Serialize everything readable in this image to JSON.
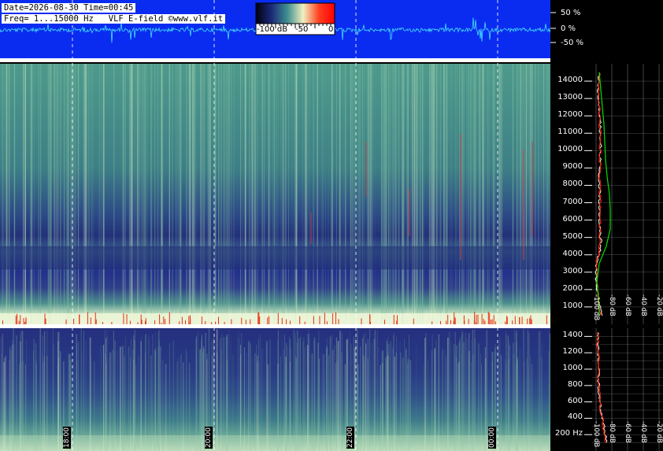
{
  "header": {
    "line1": "Date=2026-08-30 Time=00:45",
    "line2": "Freq= 1...15000 Hz   VLF E-field ©www.vlf.it"
  },
  "colorbar": {
    "labels": [
      "-100 dB",
      "-50",
      "0"
    ],
    "colors": [
      "#000010",
      "#1b2a78",
      "#3f8f8f",
      "#f0f0c0",
      "#ff4020",
      "#ff0000"
    ]
  },
  "waveform_axis": {
    "labels": [
      "50 %",
      "0 %",
      "-50 %"
    ]
  },
  "colors": {
    "waveform_bg": "#0a2cf0",
    "waveform_line": "#45e0ff",
    "spectrum_white": "#ffffff",
    "spectrum_red": "#ff2000",
    "spectrum_green": "#00e000"
  },
  "chart_data": [
    {
      "type": "line",
      "title": "",
      "panel": "waveform",
      "ylabels": [
        "50 %",
        "0 %",
        "-50 %"
      ],
      "ylim": [
        -75,
        75
      ]
    },
    {
      "type": "heatmap",
      "panel": "spectrogram-full",
      "yunit": "Hz",
      "ylim": [
        0,
        15000
      ],
      "yticks": [
        1000,
        2000,
        3000,
        4000,
        5000,
        6000,
        7000,
        8000,
        9000,
        10000,
        11000,
        12000,
        13000,
        14000
      ],
      "ytick_labels": [
        "1000",
        "2000",
        "3000",
        "4000",
        "5000",
        "6000",
        "7000",
        "8000",
        "9000",
        "10000",
        "11000",
        "12000",
        "13000",
        "14000"
      ],
      "colorscale_db": [
        -100,
        0
      ]
    },
    {
      "type": "heatmap",
      "panel": "spectrogram-low",
      "yunit": "Hz",
      "ylim": [
        0,
        1500
      ],
      "yticks": [
        200,
        400,
        600,
        800,
        1000,
        1200,
        1400
      ],
      "ytick_labels": [
        "200 Hz",
        "400",
        "600",
        "800",
        "1000",
        "1200",
        "1400"
      ],
      "xtick_labels": [
        "18:00",
        "20:00",
        "22:00",
        "00:00"
      ],
      "colorscale_db": [
        -100,
        0
      ]
    },
    {
      "type": "line",
      "panel": "spectrum-profile-full",
      "xticks_db": [
        -100,
        -80,
        -60,
        -40,
        -20
      ],
      "xtick_labels": [
        "-100 dB",
        "-80 dB",
        "-60 dB",
        "-40 dB",
        "-20 dB"
      ],
      "ylim": [
        0,
        15000
      ],
      "series": [
        {
          "color": "white",
          "freq": [
            500,
            1500,
            2500,
            3500,
            4500,
            5500,
            6500,
            7500,
            8500,
            9500,
            10500,
            11500,
            12500,
            13500,
            14500
          ],
          "db": [
            -92,
            -97,
            -100,
            -99,
            -94,
            -95,
            -96,
            -95,
            -96,
            -95,
            -94,
            -95,
            -96,
            -97,
            -96
          ]
        },
        {
          "color": "red",
          "freq": [
            500,
            1500,
            2500,
            3500,
            4500,
            5500,
            6500,
            7500,
            8500,
            9500,
            10500,
            11500,
            12500,
            13500,
            14500
          ],
          "db": [
            -95,
            -97,
            -99,
            -99,
            -96,
            -95,
            -95,
            -95,
            -95,
            -95,
            -95,
            -95,
            -96,
            -96,
            -96
          ]
        },
        {
          "color": "green",
          "freq": [
            500,
            1500,
            2500,
            3500,
            4500,
            5500,
            6500,
            7500,
            8500,
            9500,
            10500,
            11500,
            12500,
            13500,
            14500
          ],
          "db": [
            -96,
            -97,
            -99,
            -96,
            -87,
            -82,
            -82,
            -83,
            -86,
            -88,
            -89,
            -90,
            -92,
            -94,
            -96
          ]
        }
      ]
    },
    {
      "type": "line",
      "panel": "spectrum-profile-low",
      "xtick_labels": [
        "-100 dB",
        "-80 dB",
        "-60 dB",
        "-40 dB",
        "-20 dB"
      ],
      "ylim": [
        0,
        1500
      ],
      "series": [
        {
          "color": "white",
          "freq": [
            100,
            300,
            500,
            700,
            900,
            1100,
            1300,
            1450
          ],
          "db": [
            -86,
            -90,
            -94,
            -97,
            -97,
            -97,
            -98,
            -98
          ]
        },
        {
          "color": "red",
          "freq": [
            100,
            300,
            500,
            700,
            900,
            1100,
            1300,
            1450
          ],
          "db": [
            -88,
            -91,
            -94,
            -96,
            -97,
            -97,
            -98,
            -98
          ]
        }
      ]
    }
  ]
}
